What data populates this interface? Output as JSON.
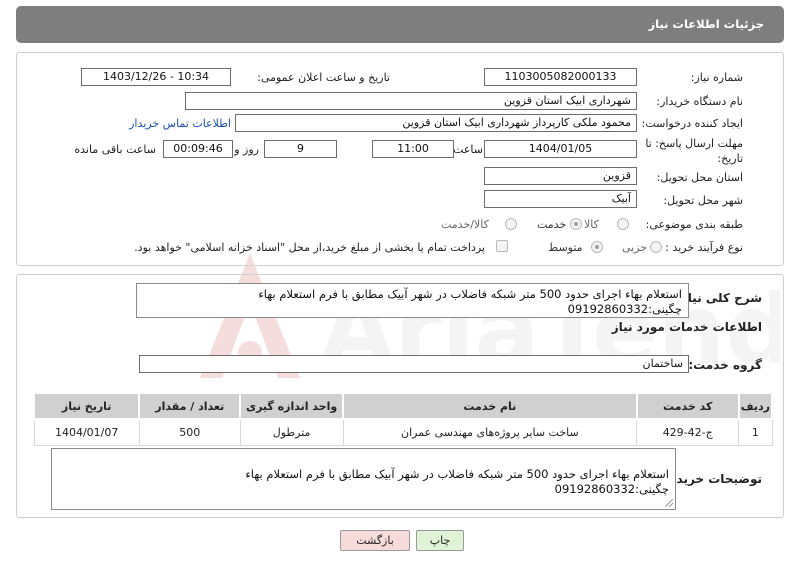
{
  "header": {
    "title": "جزئیات اطلاعات نیاز"
  },
  "need_number": {
    "label": "شماره نیاز:",
    "value": "1103005082000133"
  },
  "announce": {
    "label": "تاریخ و ساعت اعلان عمومی:",
    "value": "1403/12/26 - 10:34"
  },
  "buyer": {
    "label": "نام دستگاه خریدار:",
    "value": "شهرداری ابیک استان قزوین"
  },
  "creator": {
    "label": "ایجاد کننده درخواست:",
    "value": "محمود ملکی کارپرداز شهرداری ابیک استان قزوین",
    "contact_link": "اطلاعات تماس خریدار"
  },
  "deadline": {
    "label": "مهلت ارسال پاسخ: تا تاریخ:",
    "date": "1404/01/05",
    "time_label": "ساعت",
    "time": "11:00",
    "days": "9",
    "days_label": "روز و",
    "remaining": "00:09:46",
    "remaining_label": "ساعت باقی مانده"
  },
  "province": {
    "label": "استان محل تحویل:",
    "value": "قزوین"
  },
  "city": {
    "label": "شهر محل تحویل:",
    "value": "آبیک"
  },
  "category": {
    "label": "طبقه بندی موضوعی:",
    "options": [
      "کالا",
      "خدمت",
      "کالا/خدمت"
    ],
    "selected": "خدمت"
  },
  "purchase": {
    "label": "نوع فرآیند خرید :",
    "options": [
      "جزیی",
      "متوسط"
    ],
    "selected": "متوسط",
    "note": "پرداخت تمام یا بخشی از مبلغ خرید،از محل \"اسناد خزانه اسلامی\" خواهد بود."
  },
  "summary": {
    "label": "شرح کلی نیاز:",
    "text": "استعلام بهاء اجرای حدود 500 متر شبکه فاضلاب در شهر آبیک مطابق با فرم استعلام بهاء\nچگینی:09192860332"
  },
  "services_title": "اطلاعات خدمات مورد نیاز",
  "service_group": {
    "label": "گروه خدمت:",
    "value": "ساختمان"
  },
  "table": {
    "headers": [
      "ردیف",
      "کد خدمت",
      "نام خدمت",
      "واحد اندازه گیری",
      "تعداد / مقدار",
      "تاریخ نیاز"
    ],
    "rows": [
      [
        "1",
        "ج-42-429",
        "ساخت سایر پروژه‌های مهندسی عمران",
        "مترطول",
        "500",
        "1404/01/07"
      ]
    ]
  },
  "buyer_notes": {
    "label": "توضیحات خریدار:",
    "text": "استعلام بهاء اجرای حدود 500 متر شبکه فاضلاب در شهر آبیک مطابق با فرم استعلام بهاء\nچگینی:09192860332"
  },
  "buttons": {
    "print": "چاپ",
    "back": "بازگشت"
  },
  "watermark": {
    "text": "AriaTender.net"
  },
  "colors": {
    "header_bg": "#7e7e7e",
    "link": "#1a4fb3",
    "print_bg": "#dff3d6",
    "back_bg": "#f7dada"
  }
}
